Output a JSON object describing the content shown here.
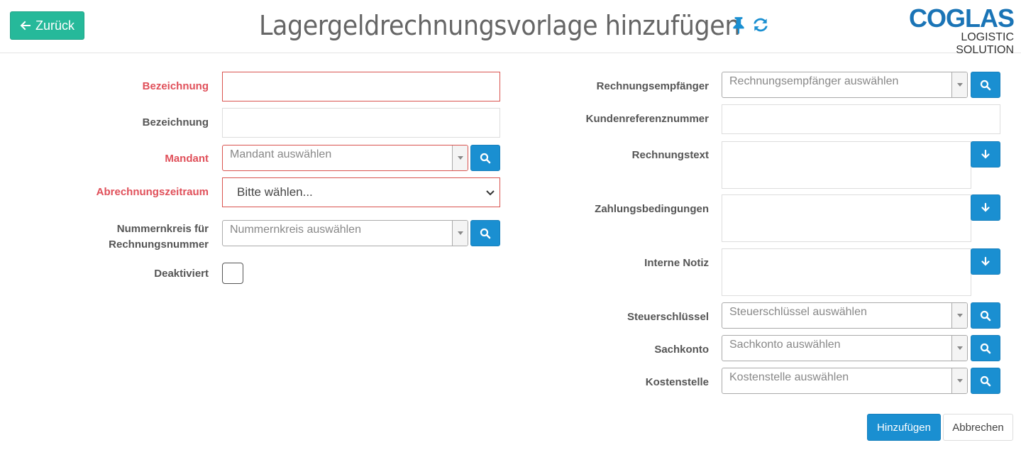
{
  "header": {
    "back_label": "Zurück",
    "title": "Lagergeldrechnungsvorlage hinzufügen",
    "logo_main": "COGLAS",
    "logo_sub": "LOGISTIC SOLUTION"
  },
  "left": {
    "bezeichnung_req_label": "Bezeichnung",
    "bezeichnung_label": "Bezeichnung",
    "mandant_label": "Mandant",
    "mandant_placeholder": "Mandant auswählen",
    "abrechnungszeitraum_label": "Abrechnungszeitraum",
    "abrechnungszeitraum_value": "Bitte wählen...",
    "nummernkreis_label_line1": "Nummernkreis für",
    "nummernkreis_label_line2": "Rechnungsnummer",
    "nummernkreis_placeholder": "Nummernkreis auswählen",
    "deaktiviert_label": "Deaktiviert"
  },
  "right": {
    "rechnungsempfaenger_label": "Rechnungsempfänger",
    "rechnungsempfaenger_placeholder": "Rechnungsempfänger auswählen",
    "kundenreferenz_label": "Kundenreferenznummer",
    "rechnungstext_label": "Rechnungstext",
    "zahlungsbedingungen_label": "Zahlungsbedingungen",
    "interne_notiz_label": "Interne Notiz",
    "steuerschluessel_label": "Steuerschlüssel",
    "steuerschluessel_placeholder": "Steuerschlüssel auswählen",
    "sachkonto_label": "Sachkonto",
    "sachkonto_placeholder": "Sachkonto auswählen",
    "kostenstelle_label": "Kostenstelle",
    "kostenstelle_placeholder": "Kostenstelle auswählen"
  },
  "actions": {
    "submit_label": "Hinzufügen",
    "cancel_label": "Abbrechen"
  },
  "colors": {
    "accent_green": "#26b99a",
    "primary_blue": "#1a8fd1",
    "required_red": "#e0505a",
    "logo_blue": "#1a74b6"
  },
  "icons": {
    "back": "arrow-left-icon",
    "pin": "pin-icon",
    "refresh": "refresh-icon",
    "search": "search-icon",
    "insert": "arrow-down-icon"
  }
}
